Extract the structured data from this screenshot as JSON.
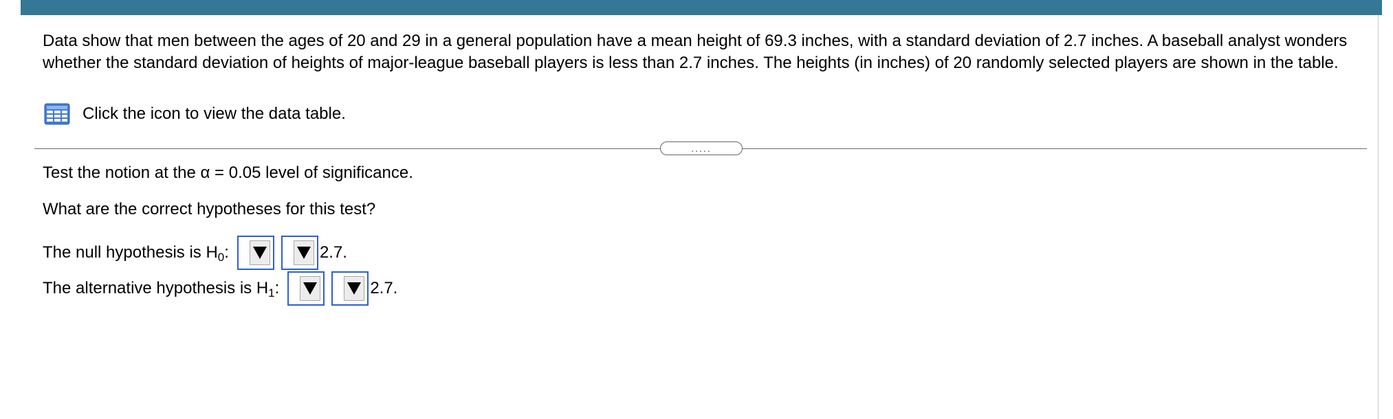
{
  "problem": {
    "text": "Data show that men between the ages of 20 and 29 in a general population have a mean height of 69.3 inches, with a standard deviation of 2.7 inches. A baseball analyst wonders whether the standard deviation of heights of major-league baseball players is less than 2.7 inches. The heights (in inches) of 20 randomly selected players are shown in the table.",
    "table_link_label": "Click the icon to view the data table."
  },
  "expand_handle": {
    "label": "....."
  },
  "task": {
    "significance_prefix": "Test the notion at the ",
    "significance_symbol": "α",
    "significance_value": " = 0.05 level of significance.",
    "question": "What are the correct hypotheses for this test?"
  },
  "hypotheses": {
    "null": {
      "label": "The null hypothesis is H",
      "subscript": "0",
      "colon": ":",
      "value": "2.7."
    },
    "alternative": {
      "label": "The alternative hypothesis is H",
      "subscript": "1",
      "colon": ":",
      "value": "2.7."
    }
  },
  "icons": {
    "table": "data-table-grid-icon",
    "dropdown": "dropdown-arrow-icon"
  },
  "colors": {
    "top_bar": "#347896",
    "focus_border": "#2f5fd0",
    "icon_blue": "#3f7ad6"
  }
}
